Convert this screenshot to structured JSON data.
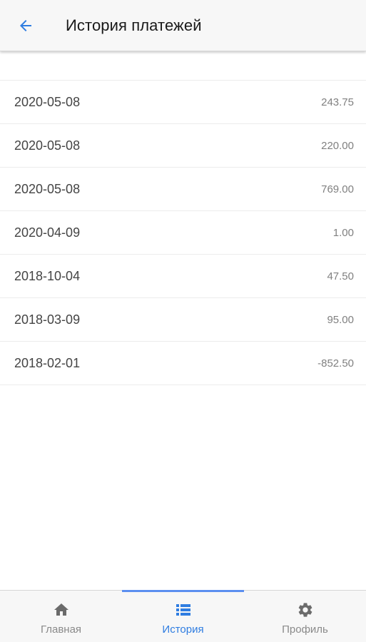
{
  "header": {
    "back_icon": "arrow-left-icon",
    "title": "История платежей",
    "accent_color": "#2f7de1"
  },
  "payments": [
    {
      "date": "2020-05-08",
      "amount": "243.75"
    },
    {
      "date": "2020-05-08",
      "amount": "220.00"
    },
    {
      "date": "2020-05-08",
      "amount": "769.00"
    },
    {
      "date": "2020-04-09",
      "amount": "1.00"
    },
    {
      "date": "2018-10-04",
      "amount": "47.50"
    },
    {
      "date": "2018-03-09",
      "amount": "95.00"
    },
    {
      "date": "2018-02-01",
      "amount": "-852.50"
    }
  ],
  "bottom_nav": {
    "items": [
      {
        "label": "Главная",
        "icon": "home-icon",
        "active": false
      },
      {
        "label": "История",
        "icon": "list-icon",
        "active": true
      },
      {
        "label": "Профиль",
        "icon": "gear-icon",
        "active": false
      }
    ]
  }
}
